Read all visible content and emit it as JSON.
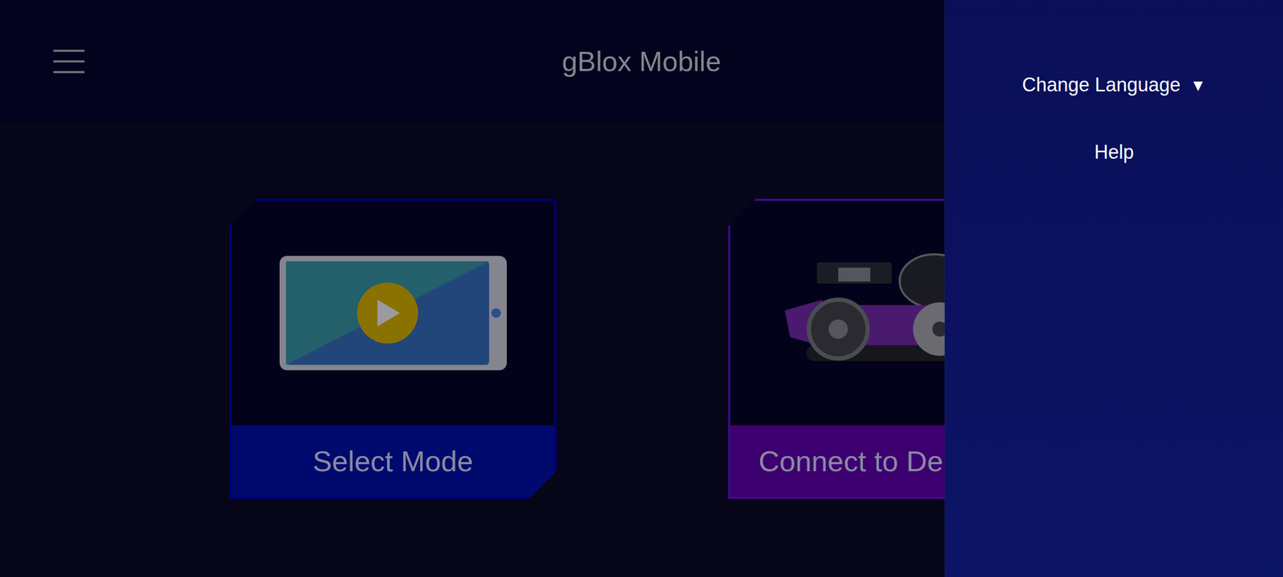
{
  "header": {
    "title": "gBlox Mobile"
  },
  "cards": [
    {
      "label": "Select Mode",
      "kind": "phone",
      "color": "#000a6e",
      "border": "#00007a"
    },
    {
      "label": "Connect to De",
      "kind": "robot",
      "color": "#3d0070",
      "border": "#3a0a88"
    }
  ],
  "drawer": {
    "open": true,
    "items": [
      {
        "label": "Change Language",
        "dropdown": "▼"
      },
      {
        "label": "Help",
        "dropdown": ""
      }
    ]
  }
}
